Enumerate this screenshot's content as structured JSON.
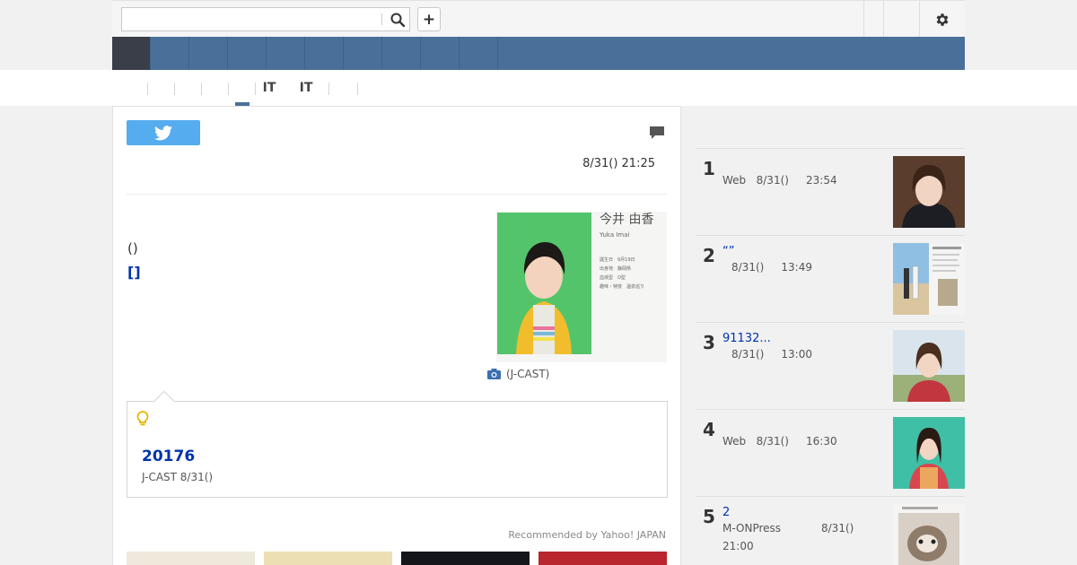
{
  "search": {
    "placeholder": "",
    "value": ""
  },
  "toolbar": {
    "add_label": "+"
  },
  "category_nav": {
    "items": [
      "",
      "",
      "",
      "",
      "",
      "",
      "",
      "",
      "",
      ""
    ]
  },
  "sub_nav": {
    "items": [
      "",
      "",
      "",
      "",
      "",
      "IT",
      "",
      ""
    ],
    "active_index": 4
  },
  "article": {
    "datetime": "8/31() 21:25",
    "body_text": "()",
    "link_text": "[]",
    "photo_name_jp": "今井 由香",
    "photo_name_en": "Yuka Imai",
    "photo_details": [
      "誕生日　9月19日",
      "出身地　静岡県",
      "血液型　O型",
      "趣味・特技　温泉巡り"
    ],
    "photo_caption": "(J-CAST)"
  },
  "related": {
    "title": "20176",
    "source": "J-CAST 8/31()"
  },
  "recommended_label": "Recommended by Yahoo! JAPAN",
  "ranking": [
    {
      "num": "1",
      "title": "",
      "source": "Web",
      "date": "8/31()",
      "time": "23:54"
    },
    {
      "num": "2",
      "title": "“”",
      "source": "",
      "date": "8/31()",
      "time": "13:49"
    },
    {
      "num": "3",
      "title": "91132...",
      "source": "",
      "date": "8/31()",
      "time": "13:00"
    },
    {
      "num": "4",
      "title": "",
      "source": "Web",
      "date": "8/31()",
      "time": "16:30"
    },
    {
      "num": "5",
      "title": "2",
      "source": "M-ONPress",
      "date": "8/31()",
      "time": "21:00"
    }
  ],
  "colors": {
    "nav_blue": "#4a709a",
    "nav_active": "#3a3e48",
    "twitter_blue": "#55acee",
    "link_blue": "#0033aa"
  },
  "icons": [
    "search-icon",
    "plus-icon",
    "gear-icon",
    "twitter-icon",
    "comment-icon",
    "camera-icon",
    "bulb-icon"
  ]
}
